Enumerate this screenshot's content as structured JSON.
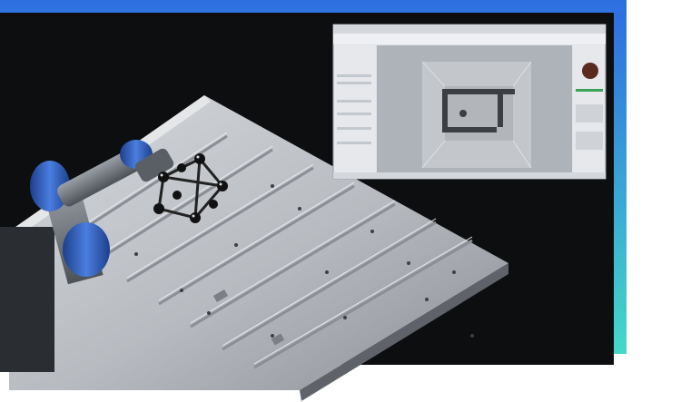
{
  "scene": {
    "subject": "machined-plate-with-robot-arm",
    "colors": {
      "background": "#0d0e10",
      "gradient_top": "#2f6fe0",
      "gradient_bottom": "#45d8c8",
      "metal_light": "#c9ccd0",
      "metal_dark": "#6d7177",
      "robot_blue": "#2f5fbf",
      "probe_black": "#111111"
    }
  },
  "inset_screenshot": {
    "window": "measurement-software",
    "colors": {
      "viewport": "#aeb3b9",
      "panel": "#e6e8ec",
      "titlebar": "#d4d7dc"
    }
  }
}
